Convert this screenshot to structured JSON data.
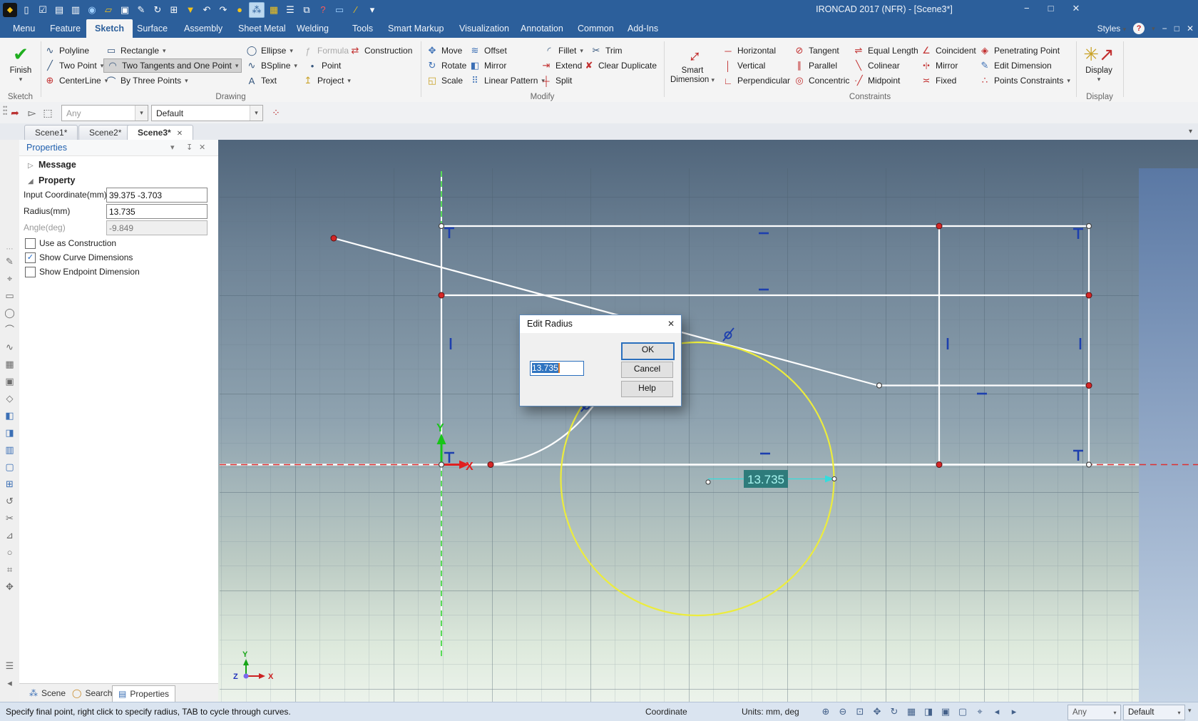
{
  "ui": {
    "caret": "▾",
    "close": "✕",
    "pin": "↧",
    "minimize": "−",
    "maximize": "□",
    "expander_closed": "▷",
    "expander_open": "◢",
    "handle": "⋯",
    "check": "✓"
  },
  "titlebar": {
    "title": "IRONCAD 2017 (NFR) - [Scene3*]",
    "qat_icons": [
      {
        "g": "◆",
        "c": "logo"
      },
      {
        "g": "▯",
        "c": "w"
      },
      {
        "g": "☑",
        "c": "w"
      },
      {
        "g": "▤",
        "c": "w"
      },
      {
        "g": "▥",
        "c": "w"
      },
      {
        "g": "◉",
        "c": "b"
      },
      {
        "g": "▱",
        "c": "y"
      },
      {
        "g": "▣",
        "c": "w"
      },
      {
        "g": "✎",
        "c": "w"
      },
      {
        "g": "↻",
        "c": "w"
      },
      {
        "g": "⊞",
        "c": "w"
      },
      {
        "g": "▼",
        "c": "y"
      },
      {
        "g": "↶",
        "c": "w"
      },
      {
        "g": "↷",
        "c": "w"
      },
      {
        "g": "●",
        "c": "y"
      },
      {
        "g": "⁂",
        "c": "hl"
      },
      {
        "g": "▦",
        "c": "y"
      },
      {
        "g": "☰",
        "c": "w"
      },
      {
        "g": "⧉",
        "c": "w"
      },
      {
        "g": "?",
        "c": "r"
      },
      {
        "g": "▭",
        "c": "b"
      },
      {
        "g": "∕",
        "c": "y"
      },
      {
        "g": "▾",
        "c": "w"
      }
    ]
  },
  "menu": {
    "tabs": [
      "Menu",
      "Feature",
      "Sketch",
      "Surface",
      "Assembly",
      "Sheet Metal",
      "Welding",
      "Tools",
      "Smart Markup",
      "Visualization",
      "Annotation",
      "Common",
      "Add-Ins"
    ],
    "styles_label": "Styles",
    "help_glyph": "?"
  },
  "ribbon": {
    "finish": {
      "label": "Finish"
    },
    "group_labels": {
      "sketch": "Sketch",
      "drawing": "Drawing",
      "modify": "Modify",
      "constraints": "Constraints",
      "display": "Display"
    },
    "drawing": [
      {
        "g": "∿",
        "l": "Polyline"
      },
      {
        "g": "╱",
        "l": "Two Point"
      },
      {
        "g": "⊕",
        "l": "CenterLine"
      },
      {
        "g": "▭",
        "l": "Rectangle"
      },
      {
        "g": "◠",
        "l": "Two Tangents and One Point"
      },
      {
        "g": "⌒",
        "l": "By Three Points"
      },
      {
        "g": "◯",
        "l": "Ellipse"
      },
      {
        "g": "∿",
        "l": "BSpline"
      },
      {
        "g": "A",
        "l": "Text"
      },
      {
        "g": "ƒ",
        "l": "Formula"
      },
      {
        "g": "•",
        "l": "Point"
      },
      {
        "g": "↥",
        "l": "Project"
      },
      {
        "g": "⇄",
        "l": "Construction"
      }
    ],
    "modify": [
      {
        "g": "✥",
        "l": "Move"
      },
      {
        "g": "↻",
        "l": "Rotate"
      },
      {
        "g": "◱",
        "l": "Scale"
      },
      {
        "g": "≋",
        "l": "Offset"
      },
      {
        "g": "◧",
        "l": "Mirror"
      },
      {
        "g": "⠿",
        "l": "Linear Pattern"
      },
      {
        "g": "◜",
        "l": "Fillet"
      },
      {
        "g": "⇥",
        "l": "Extend"
      },
      {
        "g": "┼",
        "l": "Split"
      },
      {
        "g": "✂",
        "l": "Trim"
      },
      {
        "g": "✘",
        "l": "Clear Duplicate"
      }
    ],
    "smart_dimension": {
      "line1": "Smart",
      "line2": "Dimension",
      "glyph": "↔"
    },
    "constraints": [
      {
        "g": "─",
        "l": "Horizontal"
      },
      {
        "g": "│",
        "l": "Vertical"
      },
      {
        "g": "∟",
        "l": "Perpendicular"
      },
      {
        "g": "⊘",
        "l": "Tangent"
      },
      {
        "g": "∥",
        "l": "Parallel"
      },
      {
        "g": "◎",
        "l": "Concentric"
      },
      {
        "g": "⇌",
        "l": "Equal Length"
      },
      {
        "g": "╲",
        "l": "Colinear"
      },
      {
        "g": "∙╱",
        "l": "Midpoint"
      },
      {
        "g": "∠",
        "l": "Coincident"
      },
      {
        "g": "•|•",
        "l": "Mirror"
      },
      {
        "g": "≍",
        "l": "Fixed"
      },
      {
        "g": "◈",
        "l": "Penetrating Point"
      },
      {
        "g": "✎",
        "l": "Edit Dimension"
      },
      {
        "g": "∴",
        "l": "Points Constraints"
      }
    ],
    "display": {
      "label": "Display",
      "glyph1": "✳",
      "glyph2": "↗"
    }
  },
  "seltoolbar": {
    "any": "Any",
    "default": "Default"
  },
  "scene_tabs": [
    "Scene1*",
    "Scene2*",
    "Scene3*"
  ],
  "left_strip": [
    {
      "g": "✎"
    },
    {
      "g": "⌖"
    },
    {
      "g": "▭"
    },
    {
      "g": "◯"
    },
    {
      "g": "⌒"
    },
    {
      "g": "∿"
    },
    {
      "g": "▦"
    },
    {
      "g": "▣"
    },
    {
      "g": "◇"
    },
    {
      "g": "◧",
      "c": "b"
    },
    {
      "g": "◨",
      "c": "b"
    },
    {
      "g": "▥",
      "c": "b"
    },
    {
      "g": "▢",
      "c": "b"
    },
    {
      "g": "⊞",
      "c": "b"
    },
    {
      "g": "↺"
    },
    {
      "g": "✂"
    },
    {
      "g": "⊿"
    },
    {
      "g": "○"
    },
    {
      "g": "⌗"
    },
    {
      "g": "✥"
    }
  ],
  "left_strip_bottom": {
    "list": "☰",
    "back": "◂"
  },
  "properties": {
    "title": "Properties",
    "sections": {
      "message": "Message",
      "property": "Property"
    },
    "fields": [
      {
        "label": "Input Coordinate(mm)",
        "value": "39.375 -3.703",
        "disabled": false
      },
      {
        "label": "Radius(mm)",
        "value": "13.735",
        "disabled": false
      },
      {
        "label": "Angle(deg)",
        "value": "-9.849",
        "disabled": true
      }
    ],
    "checkboxes": [
      {
        "label": "Use as Construction",
        "checked": false
      },
      {
        "label": "Show Curve Dimensions",
        "checked": true
      },
      {
        "label": "Show Endpoint Dimension",
        "checked": false
      }
    ],
    "bottom_tabs": [
      "Scene",
      "Search",
      "Properties"
    ]
  },
  "dialog": {
    "title": "Edit Radius",
    "value": "13.735",
    "ok": "OK",
    "cancel": "Cancel",
    "help": "Help"
  },
  "canvas": {
    "dimension_label": "13.735",
    "axis_x": "X",
    "axis_y": "Y",
    "triad": {
      "x": "X",
      "y": "Y",
      "z": "Z"
    }
  },
  "statusbar": {
    "message": "Specify final point, right click to specify radius, TAB to cycle through curves.",
    "coordinate_label": "Coordinate",
    "units_label": "Units: mm, deg",
    "icons": [
      "⊕",
      "⊖",
      "⊡",
      "✥",
      "↻",
      "▦",
      "◨",
      "▣",
      "▢",
      "⌖",
      "◂",
      "▸"
    ],
    "any": "Any",
    "default": "Default"
  }
}
